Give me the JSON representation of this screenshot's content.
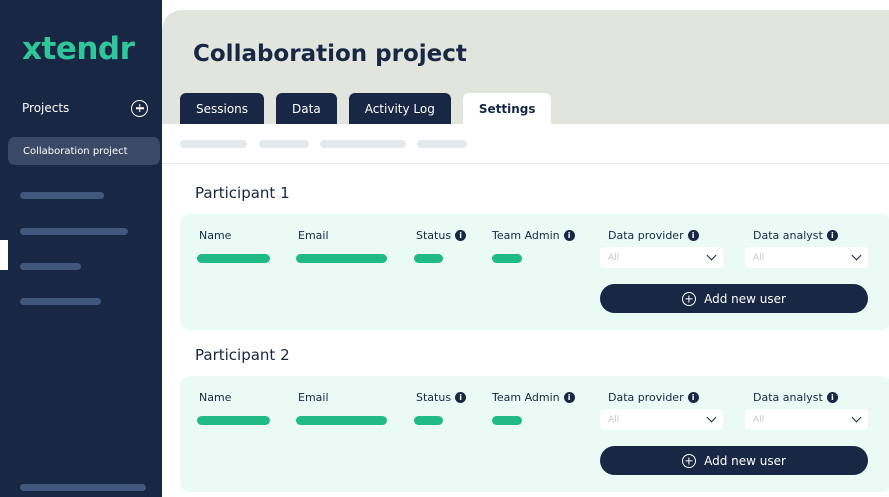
{
  "brand": {
    "logo_text": "xtendr",
    "accent": "#2fc79a",
    "navy": "#172744"
  },
  "sidebar": {
    "projects_label": "Projects",
    "add_icon": "plus-circle-icon",
    "active_project": "Collaboration project"
  },
  "main": {
    "title": "Collaboration project",
    "tabs": [
      {
        "label": "Sessions",
        "active": false
      },
      {
        "label": "Data",
        "active": false
      },
      {
        "label": "Activity Log",
        "active": false
      },
      {
        "label": "Settings",
        "active": true
      }
    ]
  },
  "participants": [
    {
      "title": "Participant 1",
      "columns": {
        "name": "Name",
        "email": "Email",
        "status": "Status",
        "team_admin": "Team Admin",
        "data_provider": "Data provider",
        "data_analyst": "Data analyst"
      },
      "data_provider_value": "All",
      "data_analyst_value": "All",
      "add_button": "Add new user"
    },
    {
      "title": "Participant 2",
      "columns": {
        "name": "Name",
        "email": "Email",
        "status": "Status",
        "team_admin": "Team Admin",
        "data_provider": "Data provider",
        "data_analyst": "Data analyst"
      },
      "data_provider_value": "All",
      "data_analyst_value": "All",
      "add_button": "Add new user"
    }
  ]
}
